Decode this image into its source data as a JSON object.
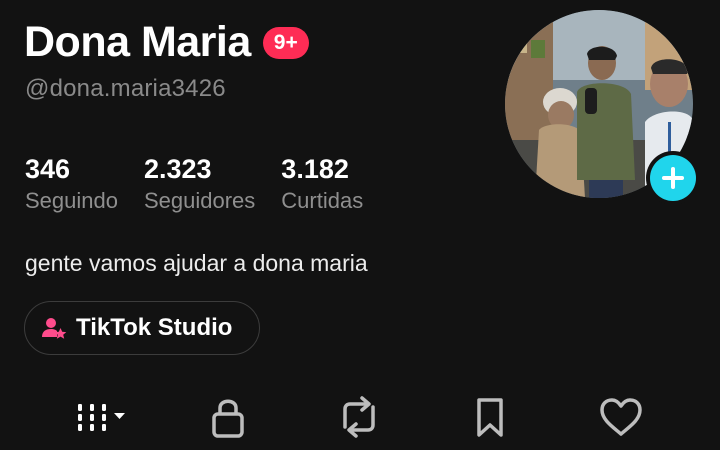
{
  "profile": {
    "display_name": "Dona Maria",
    "notification_badge": "9+",
    "username": "@dona.maria3426",
    "bio": "gente vamos ajudar a dona maria"
  },
  "stats": [
    {
      "value": "346",
      "label": "Seguindo"
    },
    {
      "value": "2.323",
      "label": "Seguidores"
    },
    {
      "value": "3.182",
      "label": "Curtidas"
    }
  ],
  "studio_button": {
    "label": "TikTok Studio",
    "icon": "tiktok-studio-icon"
  },
  "avatar": {
    "add_icon": "plus-icon"
  },
  "tabs": [
    {
      "name": "videos-grid",
      "icon": "grid-dropdown-icon",
      "active": true
    },
    {
      "name": "private",
      "icon": "lock-icon",
      "active": false
    },
    {
      "name": "reposts",
      "icon": "repost-icon",
      "active": false
    },
    {
      "name": "favorites",
      "icon": "bookmark-icon",
      "active": false
    },
    {
      "name": "liked",
      "icon": "heart-icon",
      "active": false
    }
  ],
  "colors": {
    "background": "#121212",
    "badge": "#fe2c55",
    "add_button": "#20d5ec",
    "muted_text": "#8a8a8a",
    "studio_icon": "#fe4c8c"
  }
}
